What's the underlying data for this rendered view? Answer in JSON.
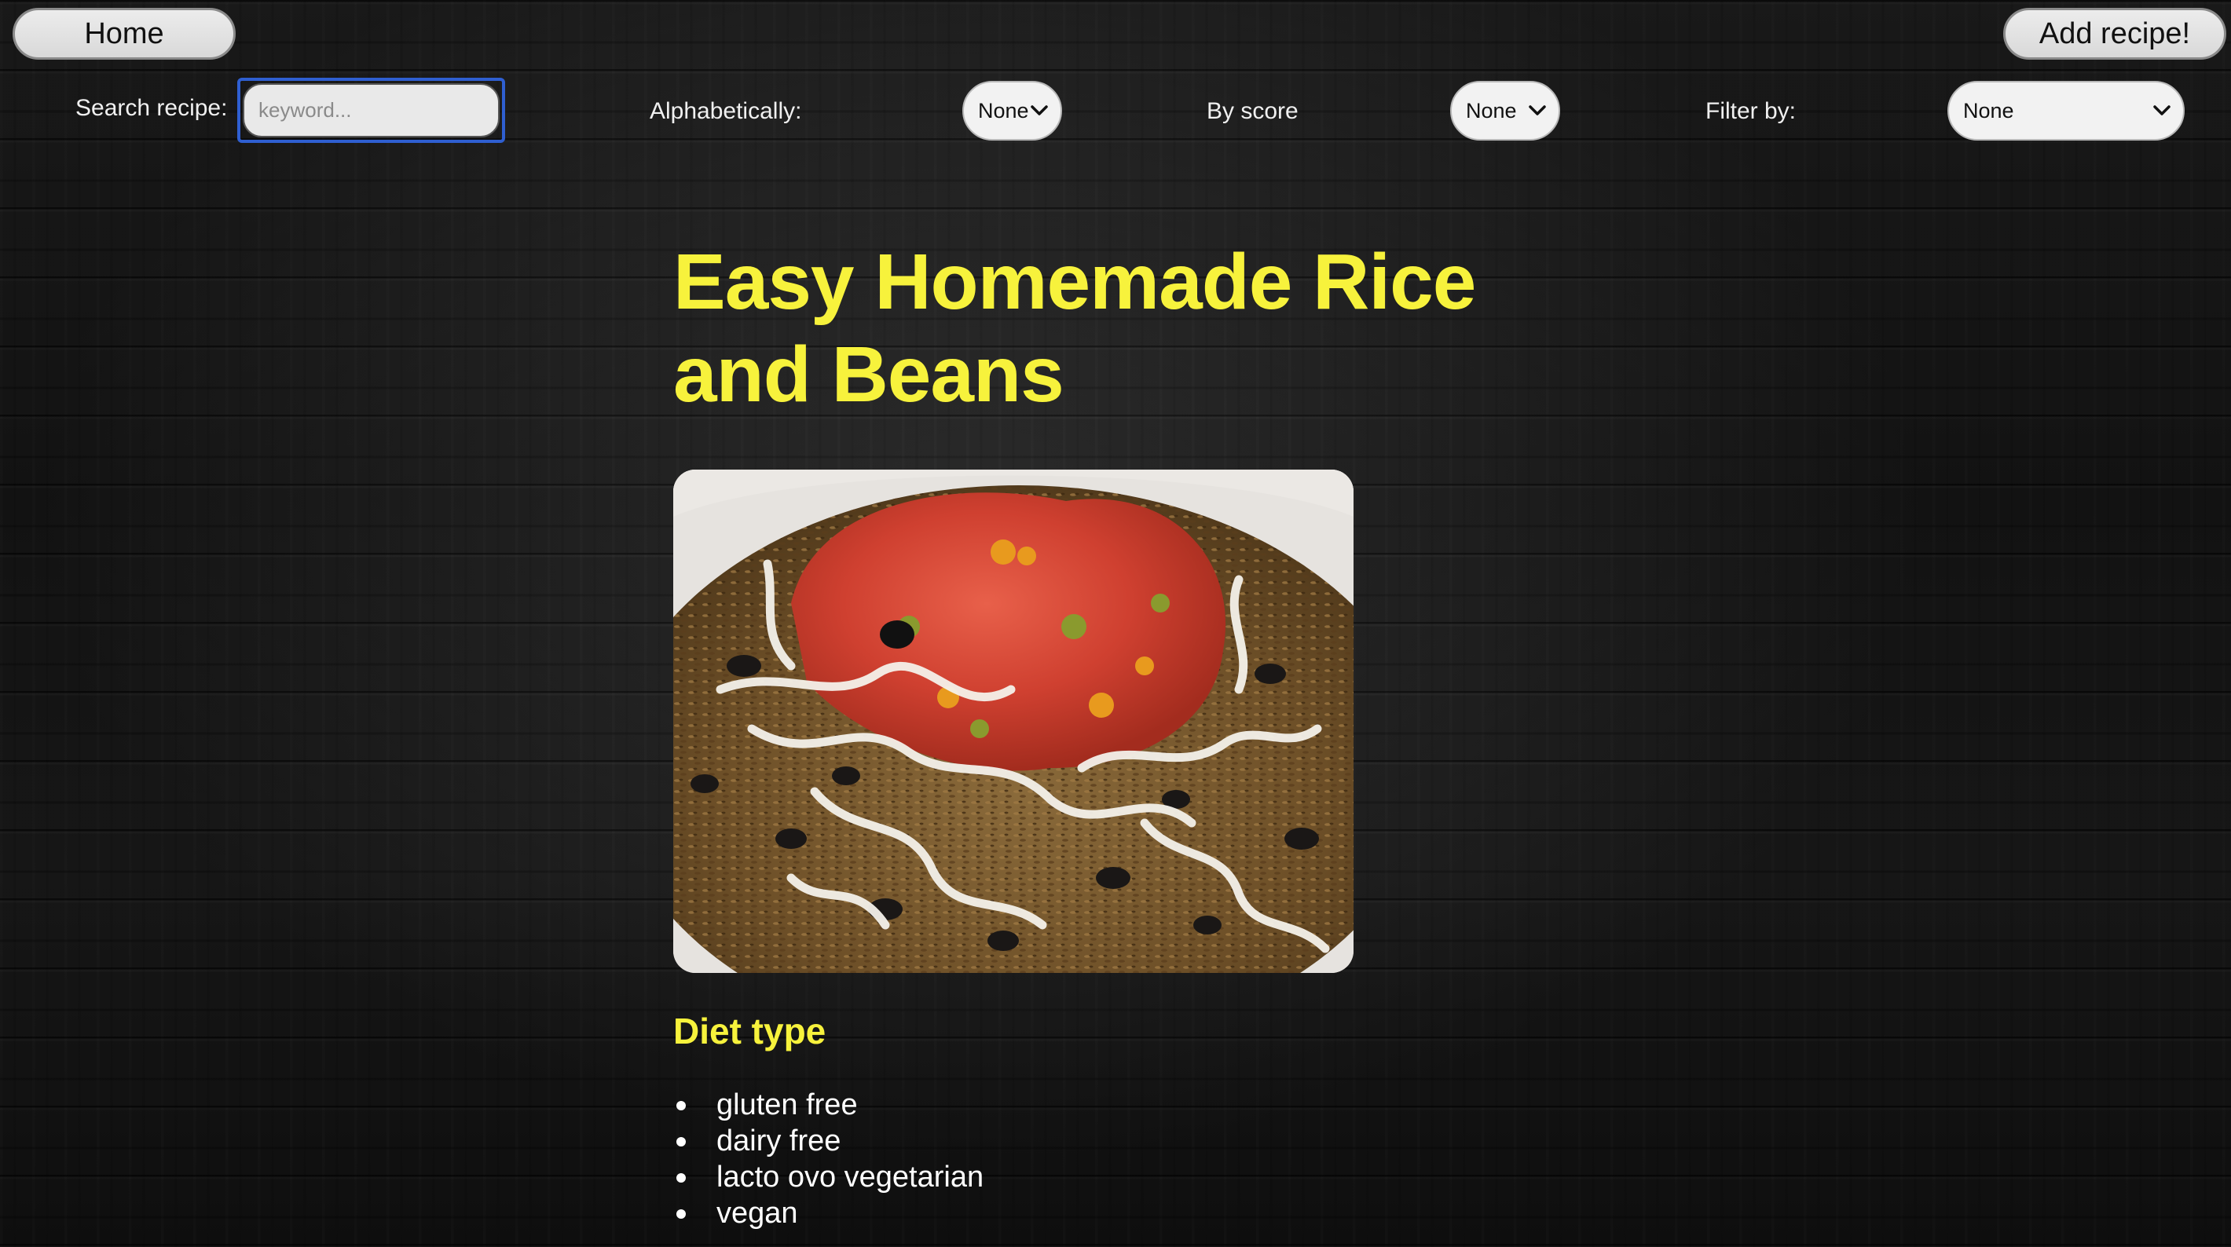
{
  "nav": {
    "home_label": "Home",
    "add_label": "Add recipe!"
  },
  "toolbar": {
    "search_label": "Search recipe:",
    "search_placeholder": "keyword...",
    "search_value": "",
    "alpha_label": "Alphabetically:",
    "alpha_selected": "None",
    "score_label": "By score",
    "score_selected": "None",
    "filter_label": "Filter by:",
    "filter_selected": "None"
  },
  "recipe": {
    "title": "Easy Homemade Rice and Beans",
    "diet_heading": "Diet type",
    "diet_types": [
      "gluten free",
      "dairy free",
      "lacto ovo vegetarian",
      "vegan"
    ]
  },
  "colors": {
    "accent": "#f7f23c",
    "background": "#1b1b1b",
    "focus_ring": "#2f5fd1",
    "button_bg": "#e3e3e3"
  },
  "icons": {
    "select_arrow": "chevron-down-icon"
  }
}
